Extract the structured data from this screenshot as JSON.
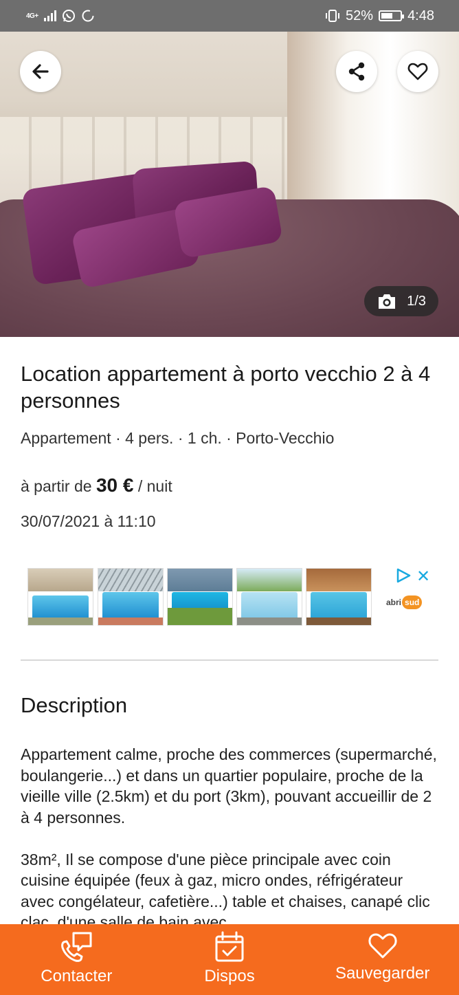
{
  "status_bar": {
    "network": "4G+",
    "battery_percent": "52%",
    "time": "4:48"
  },
  "hero": {
    "photo_counter": "1/3",
    "photo_index": 1,
    "photo_total": 3
  },
  "listing": {
    "title": "Location appartement à porto vecchio 2 à 4 personnes",
    "meta": "Appartement · 4 pers. · 1 ch. · Porto-Vecchio",
    "price_prefix": "à partir de",
    "price_value": "30 €",
    "price_suffix": "/ nuit",
    "date": "30/07/2021 à 11:10"
  },
  "ad": {
    "brand_prefix": "abri",
    "brand_suffix": "sud"
  },
  "description": {
    "heading": "Description",
    "paragraphs": [
      "Appartement calme, proche des commerces (supermarché, boulangerie...) et dans un quartier populaire, proche de la vieille ville (2.5km) et du port (3km), pouvant accueillir de 2 à 4 personnes.",
      "38m², Il se compose d'une pièce principale avec coin cuisine équipée (feux à gaz, micro ondes, réfrigérateur avec congélateur, cafetière...) table et chaises, canapé clic clac, d'une salle de bain avec"
    ]
  },
  "bottom_bar": {
    "contact_label": "Contacter",
    "dispos_label": "Dispos",
    "save_label": "Sauvegarder"
  },
  "colors": {
    "accent": "#f56b1e",
    "status_bar": "#6e6e6e"
  }
}
